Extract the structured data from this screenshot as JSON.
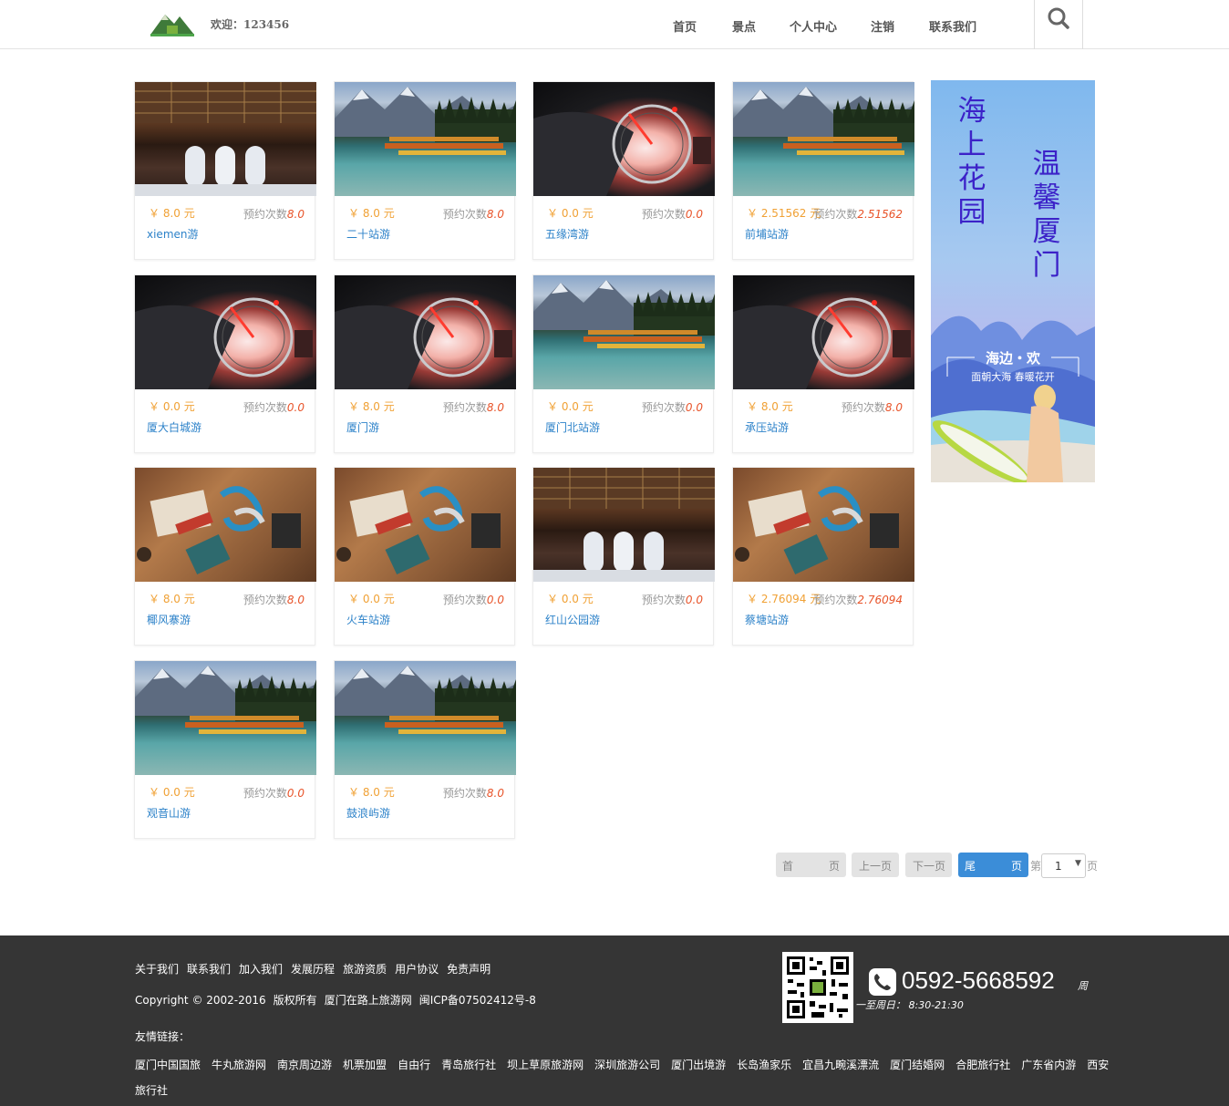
{
  "header": {
    "welcome": "欢迎：123456",
    "nav": [
      "首页",
      "景点",
      "个人中心",
      "注销",
      "联系我们"
    ]
  },
  "cards": [
    {
      "price": "￥ 8.0 元",
      "count_label": "预约次数",
      "count": "8.0",
      "name": "xiemen游",
      "image": "arch-corridor"
    },
    {
      "price": "￥ 8.0 元",
      "count_label": "预约次数",
      "count": "8.0",
      "name": "二十站游",
      "image": "mountain-lake"
    },
    {
      "price": "￥ 0.0 元",
      "count_label": "预约次数",
      "count": "0.0",
      "name": "五缘湾游",
      "image": "car-dashboard"
    },
    {
      "price": "￥ 2.51562 元",
      "count_label": "预约次数",
      "count": "2.51562",
      "name": "前埔站游",
      "image": "mountain-lake"
    },
    {
      "price": "￥ 0.0 元",
      "count_label": "预约次数",
      "count": "0.0",
      "name": "厦大白城游",
      "image": "car-dashboard"
    },
    {
      "price": "￥ 8.0 元",
      "count_label": "预约次数",
      "count": "8.0",
      "name": "厦门游",
      "image": "car-dashboard"
    },
    {
      "price": "￥ 0.0 元",
      "count_label": "预约次数",
      "count": "0.0",
      "name": "厦门北站游",
      "image": "mountain-lake"
    },
    {
      "price": "￥ 8.0 元",
      "count_label": "预约次数",
      "count": "8.0",
      "name": "承压站游",
      "image": "car-dashboard"
    },
    {
      "price": "￥ 8.0 元",
      "count_label": "预约次数",
      "count": "8.0",
      "name": "椰风寨游",
      "image": "desk-items"
    },
    {
      "price": "￥ 0.0 元",
      "count_label": "预约次数",
      "count": "0.0",
      "name": "火车站游",
      "image": "desk-items"
    },
    {
      "price": "￥ 0.0 元",
      "count_label": "预约次数",
      "count": "0.0",
      "name": "红山公园游",
      "image": "arch-corridor"
    },
    {
      "price": "￥ 2.76094 元",
      "count_label": "预约次数",
      "count": "2.76094",
      "name": "蔡塘站游",
      "image": "desk-items"
    },
    {
      "price": "￥ 0.0 元",
      "count_label": "预约次数",
      "count": "0.0",
      "name": "观音山游",
      "image": "mountain-lake"
    },
    {
      "price": "￥ 8.0 元",
      "count_label": "预约次数",
      "count": "8.0",
      "name": "鼓浪屿游",
      "image": "mountain-lake"
    }
  ],
  "banner": {
    "left_text": "海上花园",
    "right_text": "温馨厦门",
    "slogan_main": "海边・欢",
    "slogan_sub": "面朝大海 春暖花开"
  },
  "pager": {
    "first_a": "首",
    "first_b": "页",
    "prev": "上一页",
    "next": "下一页",
    "last_a": "尾",
    "last_b": "页",
    "prefix": "第",
    "current": "1",
    "suffix": "页"
  },
  "footer": {
    "links": [
      "关于我们",
      "联系我们",
      "加入我们",
      "发展历程",
      "旅游资质",
      "用户协议",
      "免责声明"
    ],
    "copyright": [
      "Copyright © 2002-2016",
      "版权所有",
      "厦门在路上旅游网",
      "闽ICP备07502412号-8"
    ],
    "friend_title": "友情链接：",
    "friend_links": [
      "厦门中国国旅",
      "牛丸旅游网",
      "南京周边游",
      "机票加盟",
      "自由行",
      "青岛旅行社",
      "坝上草原旅游网",
      "深圳旅游公司",
      "厦门出境游",
      "长岛渔家乐",
      "宜昌九畹溪漂流",
      "厦门结婚网",
      "合肥旅行社",
      "广东省内游",
      "西安旅行社"
    ],
    "phone": "0592-5668592",
    "hours_a": "周",
    "hours_b": "一至周日：  8:30-21:30"
  },
  "colors": {
    "price": "#f0a135",
    "count_value": "#e8542a",
    "name_link": "#2c82c9",
    "pager_active": "#3b8dd8",
    "footer_bg": "#353535"
  }
}
